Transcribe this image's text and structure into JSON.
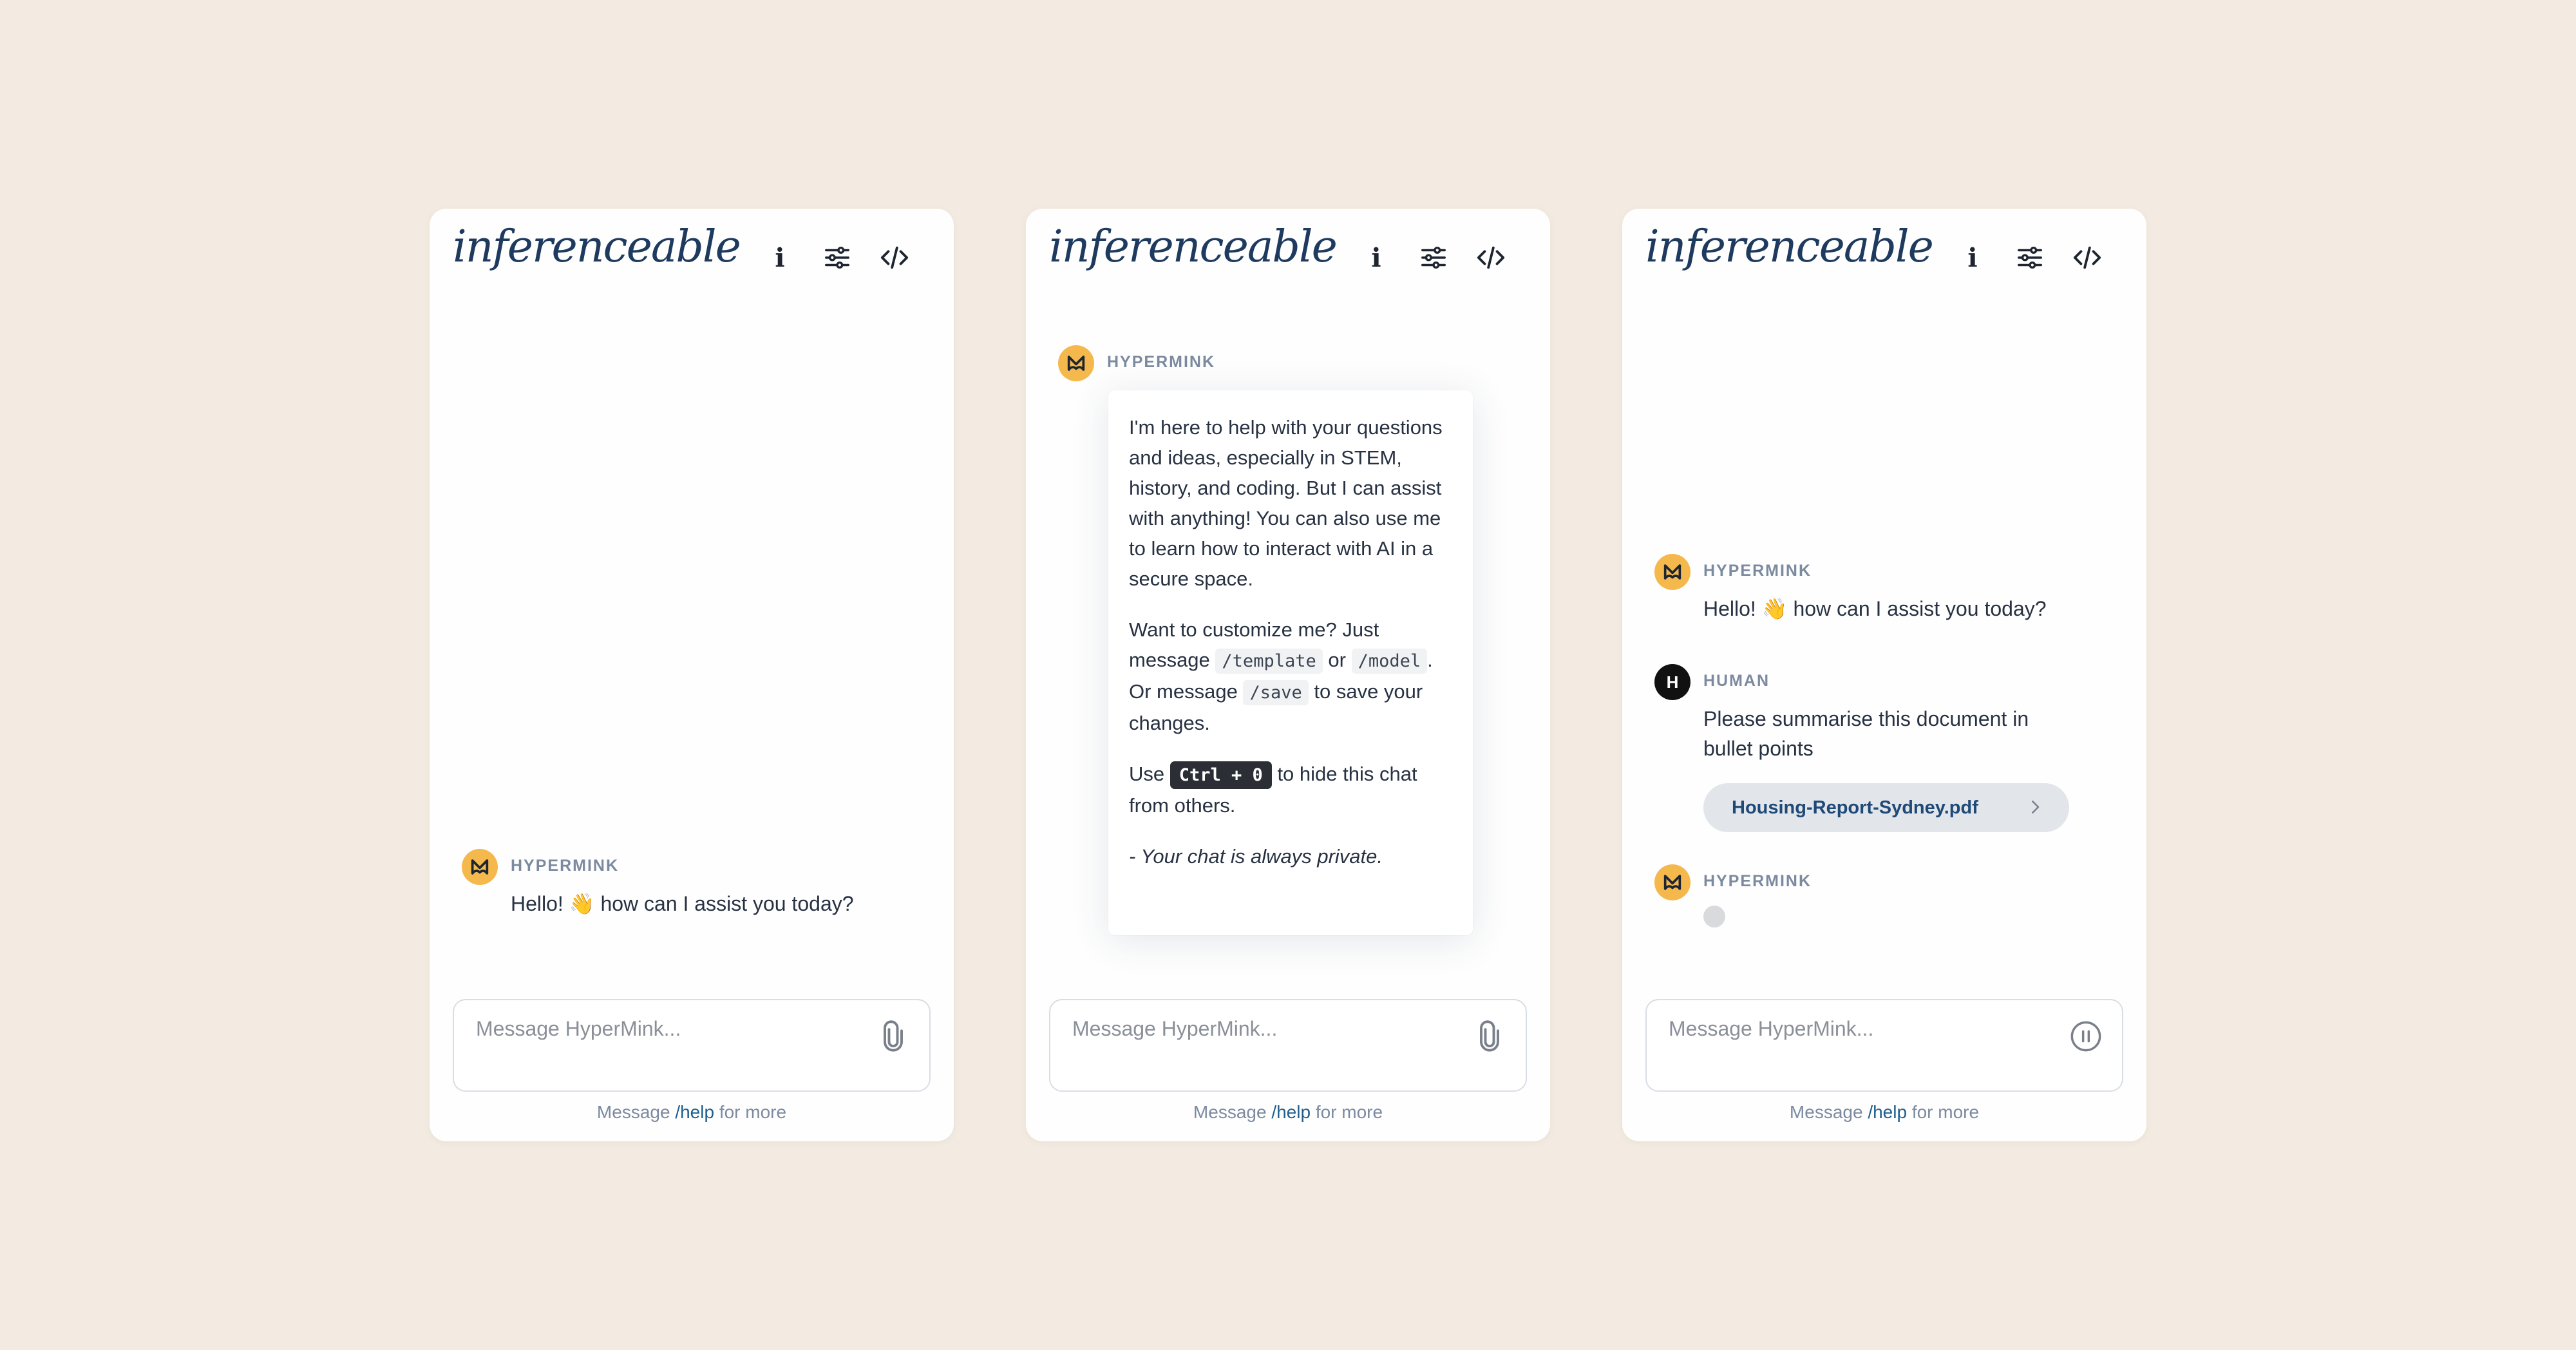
{
  "brand": {
    "logo_text": "inferenceable"
  },
  "common": {
    "input_placeholder": "Message HyperMink...",
    "footer_prefix": "Message",
    "footer_cmd": "/help",
    "footer_suffix": "for more"
  },
  "panel1": {
    "messages": [
      {
        "sender": "HYPERMINK",
        "text": "Hello! 👋 how can I assist you today?"
      }
    ]
  },
  "panel2": {
    "sender": "HYPERMINK",
    "para1": "I'm here to help with your questions and ideas, especially in STEM, history, and coding. But I can assist with anything! You can also use me to learn how to interact with AI in a secure space.",
    "para2_a": "Want to customize me? Just message",
    "cmd_template": "/template",
    "para2_or": "or",
    "cmd_model": "/model",
    "para2_b": ". Or message",
    "cmd_save": "/save",
    "para2_c": "to save your changes.",
    "para3_a": "Use",
    "kbd": "Ctrl + 0",
    "para3_b": "to hide this chat from others.",
    "para4": "- Your chat is always private."
  },
  "panel3": {
    "msg1": {
      "sender": "HYPERMINK",
      "text": "Hello! 👋 how can I assist you today?"
    },
    "msg2": {
      "sender": "HUMAN",
      "avatar_letter": "H",
      "text": "Please summarise this document in bullet points",
      "file": "Housing-Report-Sydney.pdf"
    },
    "msg3": {
      "sender": "HYPERMINK"
    }
  },
  "icons": [
    "info-icon",
    "sliders-icon",
    "code-icon",
    "paperclip-icon",
    "pause-icon",
    "chevron-right-icon",
    "hypermink-logo-icon"
  ],
  "colors": {
    "background": "#f3ebe1",
    "panel": "#fefefe",
    "avatar": "#f5b84d",
    "brand": "#1f3a5f",
    "link": "#1f5f8f"
  }
}
